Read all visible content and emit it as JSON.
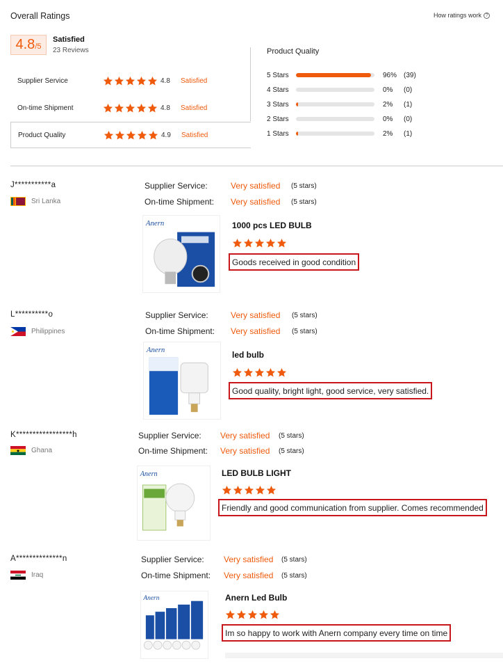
{
  "header": {
    "title": "Overall Ratings",
    "how_link": "How ratings work",
    "score": "4.8",
    "score_out_of": "/5",
    "status": "Satisfied",
    "review_count": "23 Reviews"
  },
  "breakdown": [
    {
      "name": "Supplier Service",
      "score": "4.8",
      "status": "Satisfied",
      "rating": 4.8
    },
    {
      "name": "On-time Shipment",
      "score": "4.8",
      "status": "Satisfied",
      "rating": 4.8
    },
    {
      "name": "Product Quality",
      "score": "4.9",
      "status": "Satisfied",
      "rating": 4.9
    }
  ],
  "product_quality": {
    "title": "Product Quality",
    "bars": [
      {
        "label": "5 Stars",
        "percent": "96%",
        "count": "(39)",
        "fill": 0.96
      },
      {
        "label": "4 Stars",
        "percent": "0%",
        "count": "(0)",
        "fill": 0
      },
      {
        "label": "3 Stars",
        "percent": "2%",
        "count": "(1)",
        "fill": 0.02
      },
      {
        "label": "2 Stars",
        "percent": "0%",
        "count": "(0)",
        "fill": 0
      },
      {
        "label": "1 Stars",
        "percent": "2%",
        "count": "(1)",
        "fill": 0.02
      }
    ]
  },
  "labels": {
    "supplier_service": "Supplier Service:",
    "on_time_shipment": "On-time Shipment:"
  },
  "reviews": [
    {
      "user": "J***********a",
      "country": "Sri Lanka",
      "flag": "sri-lanka",
      "service_value": "Very satisfied",
      "service_stars": "(5 stars)",
      "shipment_value": "Very satisfied",
      "shipment_stars": "(5 stars)",
      "product": "1000 pcs LED BULB",
      "rating": 5,
      "comment": "Goods received in good condition",
      "brand": "Anern"
    },
    {
      "user": "L**********o",
      "country": "Philippines",
      "flag": "philippines",
      "service_value": "Very satisfied",
      "service_stars": "(5 stars)",
      "shipment_value": "Very satisfied",
      "shipment_stars": "(5 stars)",
      "product": "led bulb",
      "rating": 5,
      "comment": "Good quality, bright light, good service, very satisfied.",
      "brand": "Anern"
    },
    {
      "user": "K*****************h",
      "country": "Ghana",
      "flag": "ghana",
      "service_value": "Very satisfied",
      "service_stars": "(5 stars)",
      "shipment_value": "Very satisfied",
      "shipment_stars": "(5 stars)",
      "product": "LED BULB LIGHT",
      "rating": 5,
      "comment": "Friendly and good communication from supplier. Comes recommended",
      "brand": "Anern"
    },
    {
      "user": "A**************n",
      "country": "Iraq",
      "flag": "iraq",
      "service_value": "Very satisfied",
      "service_stars": "(5 stars)",
      "shipment_value": "Very satisfied",
      "shipment_stars": "(5 stars)",
      "product": "Anern Led Bulb",
      "rating": 5,
      "comment": "Im so happy to work with Anern company every time on time",
      "brand": "Anern"
    }
  ],
  "colors": {
    "accent": "#f05a0c",
    "highlight_border": "#c8161d"
  }
}
